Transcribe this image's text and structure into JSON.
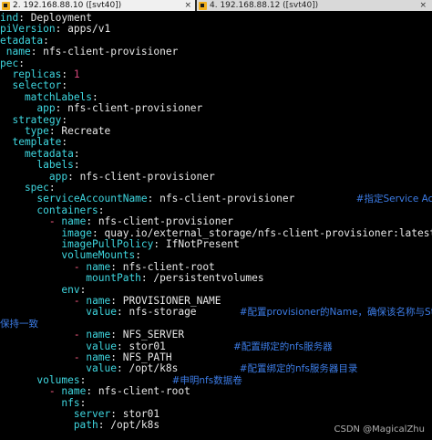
{
  "tabs": [
    {
      "label": "2. 192.168.88.10 ([svt40])",
      "close": "×"
    },
    {
      "label": "4. 192.168.88.12 ([svt40])",
      "close": "×"
    }
  ],
  "lines": [
    {
      "parts": [
        {
          "t": "ind",
          "c": "k"
        },
        {
          "t": ": Deployment",
          "c": "v"
        }
      ]
    },
    {
      "parts": [
        {
          "t": "piVersion",
          "c": "k"
        },
        {
          "t": ": apps/v1",
          "c": "v"
        }
      ]
    },
    {
      "parts": [
        {
          "t": "etadata",
          "c": "k"
        },
        {
          "t": ":",
          "c": "v"
        }
      ]
    },
    {
      "parts": [
        {
          "t": " name",
          "c": "k"
        },
        {
          "t": ": nfs-client-provisioner",
          "c": "v"
        }
      ]
    },
    {
      "parts": [
        {
          "t": "pec",
          "c": "k"
        },
        {
          "t": ":",
          "c": "v"
        }
      ]
    },
    {
      "parts": [
        {
          "t": "  replicas",
          "c": "k"
        },
        {
          "t": ": ",
          "c": "v"
        },
        {
          "t": "1",
          "c": "n"
        }
      ]
    },
    {
      "parts": [
        {
          "t": "  selector",
          "c": "k"
        },
        {
          "t": ":",
          "c": "v"
        }
      ]
    },
    {
      "parts": [
        {
          "t": "    matchLabels",
          "c": "k"
        },
        {
          "t": ":",
          "c": "v"
        }
      ]
    },
    {
      "parts": [
        {
          "t": "      app",
          "c": "k"
        },
        {
          "t": ": nfs-client-provisioner",
          "c": "v"
        }
      ]
    },
    {
      "parts": [
        {
          "t": "  strategy",
          "c": "k"
        },
        {
          "t": ":",
          "c": "v"
        }
      ]
    },
    {
      "parts": [
        {
          "t": "    type",
          "c": "k"
        },
        {
          "t": ": Recreate",
          "c": "v"
        }
      ]
    },
    {
      "parts": [
        {
          "t": "  template",
          "c": "k"
        },
        {
          "t": ":",
          "c": "v"
        }
      ]
    },
    {
      "parts": [
        {
          "t": "    metadata",
          "c": "k"
        },
        {
          "t": ":",
          "c": "v"
        }
      ]
    },
    {
      "parts": [
        {
          "t": "      labels",
          "c": "k"
        },
        {
          "t": ":",
          "c": "v"
        }
      ]
    },
    {
      "parts": [
        {
          "t": "        app",
          "c": "k"
        },
        {
          "t": ": nfs-client-provisioner",
          "c": "v"
        }
      ]
    },
    {
      "parts": [
        {
          "t": "    spec",
          "c": "k"
        },
        {
          "t": ":",
          "c": "v"
        }
      ]
    },
    {
      "parts": [
        {
          "t": "      serviceAccountName",
          "c": "k"
        },
        {
          "t": ": nfs-client-provisioner          ",
          "c": "v"
        },
        {
          "t": "#指定Service Account",
          "c": "c"
        }
      ]
    },
    {
      "parts": [
        {
          "t": "      containers",
          "c": "k"
        },
        {
          "t": ":",
          "c": "v"
        }
      ]
    },
    {
      "parts": [
        {
          "t": "        ",
          "c": "v"
        },
        {
          "t": "-",
          "c": "d"
        },
        {
          "t": " ",
          "c": "v"
        },
        {
          "t": "name",
          "c": "k"
        },
        {
          "t": ": nfs-client-provisioner",
          "c": "v"
        }
      ]
    },
    {
      "parts": [
        {
          "t": "          image",
          "c": "k"
        },
        {
          "t": ": quay.io/external_storage/nfs-client-provisioner:latest",
          "c": "v"
        }
      ]
    },
    {
      "parts": [
        {
          "t": "          imagePullPolicy",
          "c": "k"
        },
        {
          "t": ": IfNotPresent",
          "c": "v"
        }
      ]
    },
    {
      "parts": [
        {
          "t": "          volumeMounts",
          "c": "k"
        },
        {
          "t": ":",
          "c": "v"
        }
      ]
    },
    {
      "parts": [
        {
          "t": "            ",
          "c": "v"
        },
        {
          "t": "-",
          "c": "d"
        },
        {
          "t": " ",
          "c": "v"
        },
        {
          "t": "name",
          "c": "k"
        },
        {
          "t": ": nfs-client-root",
          "c": "v"
        }
      ]
    },
    {
      "parts": [
        {
          "t": "              mountPath",
          "c": "k"
        },
        {
          "t": ": /persistentvolumes",
          "c": "v"
        }
      ]
    },
    {
      "parts": [
        {
          "t": "          env",
          "c": "k"
        },
        {
          "t": ":",
          "c": "v"
        }
      ]
    },
    {
      "parts": [
        {
          "t": "            ",
          "c": "v"
        },
        {
          "t": "-",
          "c": "d"
        },
        {
          "t": " ",
          "c": "v"
        },
        {
          "t": "name",
          "c": "k"
        },
        {
          "t": ": PROVISIONER_NAME",
          "c": "v"
        }
      ]
    },
    {
      "parts": [
        {
          "t": "              value",
          "c": "k"
        },
        {
          "t": ": nfs-storage       ",
          "c": "v"
        },
        {
          "t": "#配置provisioner的Name，确保该名称与St",
          "c": "c"
        }
      ]
    },
    {
      "parts": [
        {
          "t": "保持一致",
          "c": "c"
        }
      ]
    },
    {
      "parts": [
        {
          "t": "            ",
          "c": "v"
        },
        {
          "t": "-",
          "c": "d"
        },
        {
          "t": " ",
          "c": "v"
        },
        {
          "t": "name",
          "c": "k"
        },
        {
          "t": ": NFS_SERVER",
          "c": "v"
        }
      ]
    },
    {
      "parts": [
        {
          "t": "              value",
          "c": "k"
        },
        {
          "t": ": stor01           ",
          "c": "v"
        },
        {
          "t": "#配置绑定的nfs服务器",
          "c": "c"
        }
      ]
    },
    {
      "parts": [
        {
          "t": "            ",
          "c": "v"
        },
        {
          "t": "-",
          "c": "d"
        },
        {
          "t": " ",
          "c": "v"
        },
        {
          "t": "name",
          "c": "k"
        },
        {
          "t": ": NFS_PATH",
          "c": "v"
        }
      ]
    },
    {
      "parts": [
        {
          "t": "              value",
          "c": "k"
        },
        {
          "t": ": /opt/k8s          ",
          "c": "v"
        },
        {
          "t": "#配置绑定的nfs服务器目录",
          "c": "c"
        }
      ]
    },
    {
      "parts": [
        {
          "t": "      volumes",
          "c": "k"
        },
        {
          "t": ":              ",
          "c": "v"
        },
        {
          "t": "#申明nfs数据卷",
          "c": "c"
        }
      ]
    },
    {
      "parts": [
        {
          "t": "        ",
          "c": "v"
        },
        {
          "t": "-",
          "c": "d"
        },
        {
          "t": " ",
          "c": "v"
        },
        {
          "t": "name",
          "c": "k"
        },
        {
          "t": ": nfs-client-root",
          "c": "v"
        }
      ]
    },
    {
      "parts": [
        {
          "t": "          nfs",
          "c": "k"
        },
        {
          "t": ":",
          "c": "v"
        }
      ]
    },
    {
      "parts": [
        {
          "t": "            server",
          "c": "k"
        },
        {
          "t": ": stor01",
          "c": "v"
        }
      ]
    },
    {
      "parts": [
        {
          "t": "            path",
          "c": "k"
        },
        {
          "t": ": /opt/k8s",
          "c": "v"
        }
      ]
    }
  ],
  "watermark": "CSDN @MagicalZhu"
}
